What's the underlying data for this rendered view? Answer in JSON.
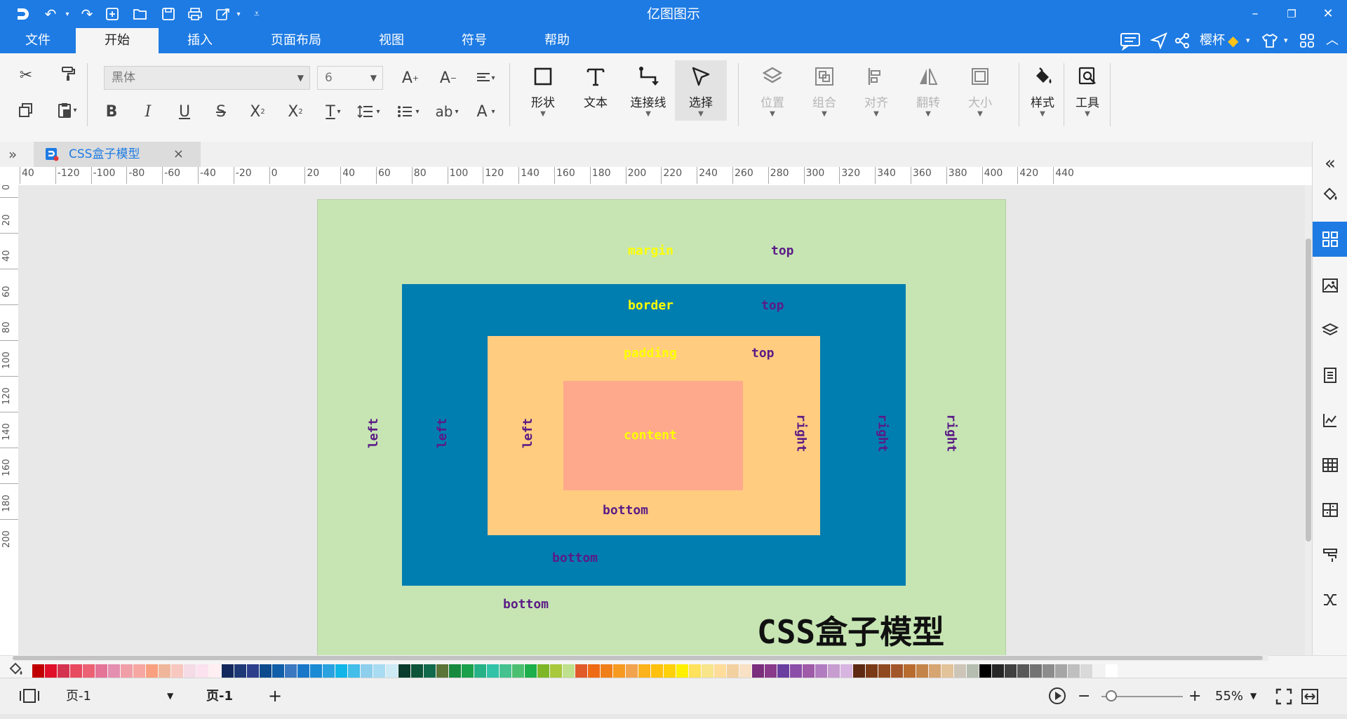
{
  "app": {
    "title": "亿图图示"
  },
  "menu": {
    "tabs": [
      "文件",
      "开始",
      "插入",
      "页面布局",
      "视图",
      "符号",
      "帮助"
    ],
    "active": "开始",
    "user_name": "樱杯"
  },
  "ribbon": {
    "font_name": "黑体",
    "font_size": "6",
    "big_buttons": [
      "形状",
      "文本",
      "连接线",
      "选择"
    ],
    "arrange_buttons": [
      "位置",
      "组合",
      "对齐",
      "翻转",
      "大小"
    ],
    "style_label": "样式",
    "tools_label": "工具",
    "superscript_mark": "2",
    "subscript_mark": "2",
    "text_sample": "ab"
  },
  "document": {
    "tab_title": "CSS盒子模型",
    "close_glyph": "×"
  },
  "ruler": {
    "h_ticks": [
      "40",
      "-120",
      "-100",
      "-80",
      "-60",
      "-40",
      "-20",
      "0",
      "20",
      "40",
      "60",
      "80",
      "100",
      "120",
      "140",
      "160",
      "180",
      "200",
      "220",
      "240",
      "260",
      "280",
      "300",
      "320",
      "340",
      "360",
      "380",
      "400",
      "420",
      "440"
    ],
    "v_ticks": [
      "0",
      "20",
      "40",
      "60",
      "80",
      "100",
      "120",
      "140",
      "160",
      "180",
      "200"
    ]
  },
  "diagram": {
    "title": "CSS盒子模型",
    "margin_label": "margin",
    "margin_top": "top",
    "margin_left": "left",
    "margin_right": "right",
    "margin_bottom": "bottom",
    "border_label": "border",
    "border_top": "top",
    "border_left": "left",
    "border_right": "right",
    "border_bottom": "bottom",
    "padding_label": "padding",
    "padding_top": "top",
    "padding_left": "left",
    "padding_right": "right",
    "padding_bottom": "bottom",
    "content_label": "content",
    "colors": {
      "margin": "#c6e5b3",
      "border": "#007eb0",
      "padding": "#ffcc80",
      "content": "#fea98c",
      "label_yellow": "#ffff00",
      "label_purple": "#5b1b86"
    }
  },
  "palette": [
    "#c00000",
    "#e0102a",
    "#d4344f",
    "#e84a5f",
    "#ec6173",
    "#e47498",
    "#e58fb0",
    "#f09ea8",
    "#f7a7a2",
    "#f8a07f",
    "#f0b69c",
    "#f8c8c0",
    "#f4dbe6",
    "#fbe2ee",
    "#ffeef2",
    "#13285c",
    "#1f3977",
    "#2c3e8c",
    "#0c4a8d",
    "#115fa8",
    "#3b78c0",
    "#1877c9",
    "#1a8ad4",
    "#2aa2e0",
    "#12b5e8",
    "#44bde8",
    "#8ecfee",
    "#a8dcf2",
    "#cdeaf5",
    "#0b3b2c",
    "#0d5438",
    "#126a4c",
    "#5b7437",
    "#188a3e",
    "#1aa04a",
    "#26b187",
    "#31c2a8",
    "#45c28f",
    "#4bbf70",
    "#1caf4b",
    "#7db728",
    "#a9c83c",
    "#bfe08c",
    "#e05a2a",
    "#ef6a14",
    "#f07f1a",
    "#f79a22",
    "#f2a34d",
    "#fbb21b",
    "#ffc10e",
    "#fed10c",
    "#fff000",
    "#ffe15c",
    "#f8e58a",
    "#ffdc9a",
    "#f2d0a0",
    "#f8e1c4",
    "#7a2e7c",
    "#8a3a8a",
    "#6b3fa0",
    "#8b4ea8",
    "#9f5aa8",
    "#b27cc0",
    "#c79dd0",
    "#d8b4e0",
    "#5e2a14",
    "#7a3a18",
    "#8f4a22",
    "#a3562a",
    "#b86c30",
    "#c4854a",
    "#d6a572",
    "#e3c39a",
    "#ccc5b8",
    "#b5bdb0",
    "#000000",
    "#262626",
    "#404040",
    "#595959",
    "#737373",
    "#8c8c8c",
    "#a6a6a6",
    "#bfbfbf",
    "#d9d9d9",
    "#f2f2f2",
    "#ffffff"
  ],
  "status": {
    "page_selector": "页-1",
    "page_tab": "页-1",
    "zoom": "55%"
  }
}
